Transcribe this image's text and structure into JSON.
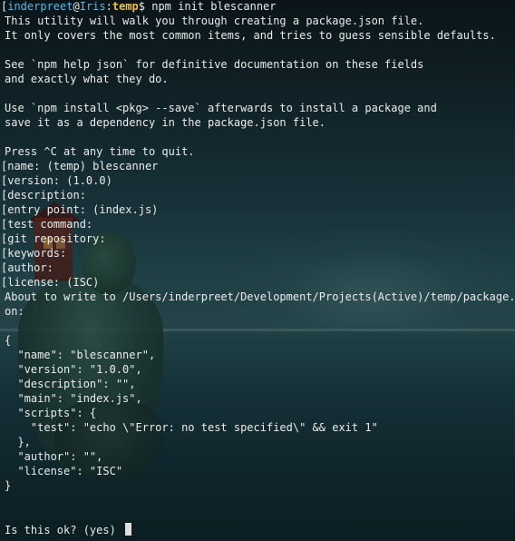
{
  "prompt": {
    "open_bracket": "[",
    "user": "inderpreet",
    "at": "@",
    "host": "Iris",
    "colon": ":",
    "dir": "temp",
    "symbol": "$",
    "command": " npm init blescanner"
  },
  "intro": [
    "This utility will walk you through creating a package.json file.",
    "It only covers the most common items, and tries to guess sensible defaults.",
    "",
    "See `npm help json` for definitive documentation on these fields",
    "and exactly what they do.",
    "",
    "Use `npm install <pkg> --save` afterwards to install a package and",
    "save it as a dependency in the package.json file.",
    "",
    "Press ^C at any time to quit."
  ],
  "questions": [
    "[name: (temp) blescanner",
    "[version: (1.0.0)",
    "[description:",
    "[entry point: (index.js)",
    "[test command:",
    "[git repository:",
    "[keywords:",
    "[author:",
    "[license: (ISC)"
  ],
  "about": [
    "About to write to /Users/inderpreet/Development/Projects(Active)/temp/package.js",
    "on:"
  ],
  "json_output": [
    "{",
    "  \"name\": \"blescanner\",",
    "  \"version\": \"1.0.0\",",
    "  \"description\": \"\",",
    "  \"main\": \"index.js\",",
    "  \"scripts\": {",
    "    \"test\": \"echo \\\"Error: no test specified\\\" && exit 1\"",
    "  },",
    "  \"author\": \"\",",
    "  \"license\": \"ISC\"",
    "}"
  ],
  "confirm": "Is this ok? (yes) ",
  "colors": {
    "text": "#e8ecec",
    "user": "#5fb8e0",
    "dir": "#f0c040"
  }
}
